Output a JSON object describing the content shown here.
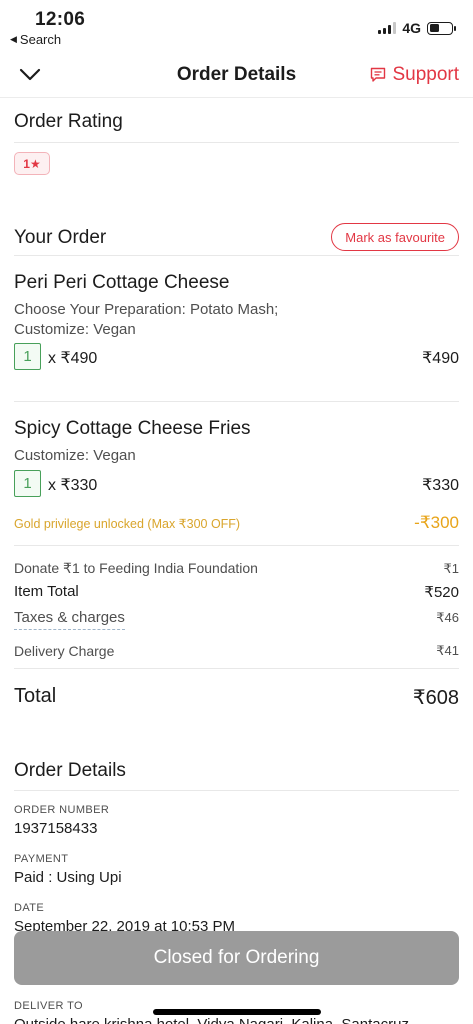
{
  "status_bar": {
    "time": "12:06",
    "back_label": "Search",
    "network": "4G"
  },
  "nav": {
    "title": "Order Details",
    "support_label": "Support"
  },
  "rating": {
    "title": "Order Rating",
    "value": "1★"
  },
  "order": {
    "title": "Your Order",
    "favourite_label": "Mark as favourite",
    "items": [
      {
        "name": "Peri Peri Cottage Cheese",
        "description": "Choose Your Preparation: Potato Mash; Customize: Vegan",
        "quantity": "1",
        "unit_price": "x ₹490",
        "line_total": "₹490"
      },
      {
        "name": "Spicy Cottage Cheese Fries",
        "description": "Customize: Vegan",
        "quantity": "1",
        "unit_price": "x ₹330",
        "line_total": "₹330"
      }
    ],
    "gold_label": "Gold privilege unlocked (Max ₹300 OFF)",
    "gold_amount": "-₹300"
  },
  "bill": {
    "donate_label": "Donate ₹1 to Feeding India Foundation",
    "donate_value": "₹1",
    "item_total_label": "Item Total",
    "item_total_value": "₹520",
    "taxes_label": "Taxes & charges",
    "taxes_value": "₹46",
    "delivery_label": "Delivery Charge",
    "delivery_value": "₹41",
    "total_label": "Total",
    "total_value": "₹608"
  },
  "details": {
    "title": "Order Details",
    "order_number_label": "ORDER NUMBER",
    "order_number": "1937158433",
    "payment_label": "PAYMENT",
    "payment": "Paid : Using Upi",
    "date_label": "DATE",
    "date": "September 22, 2019 at 10:53 PM",
    "deliver_to_label": "DELIVER TO",
    "deliver_to": "Outside hare krishna hotel, Vidya Nagari, Kalina, Santacruz"
  },
  "footer": {
    "closed_label": "Closed for Ordering"
  },
  "colors": {
    "brand_red": "#e23744",
    "veg_green": "#48a05a",
    "gold": "#e8a419",
    "disabled_button": "#9b9b9b"
  },
  "icons": {
    "back": "chevron-down-icon",
    "support": "chat-bubble-icon"
  }
}
